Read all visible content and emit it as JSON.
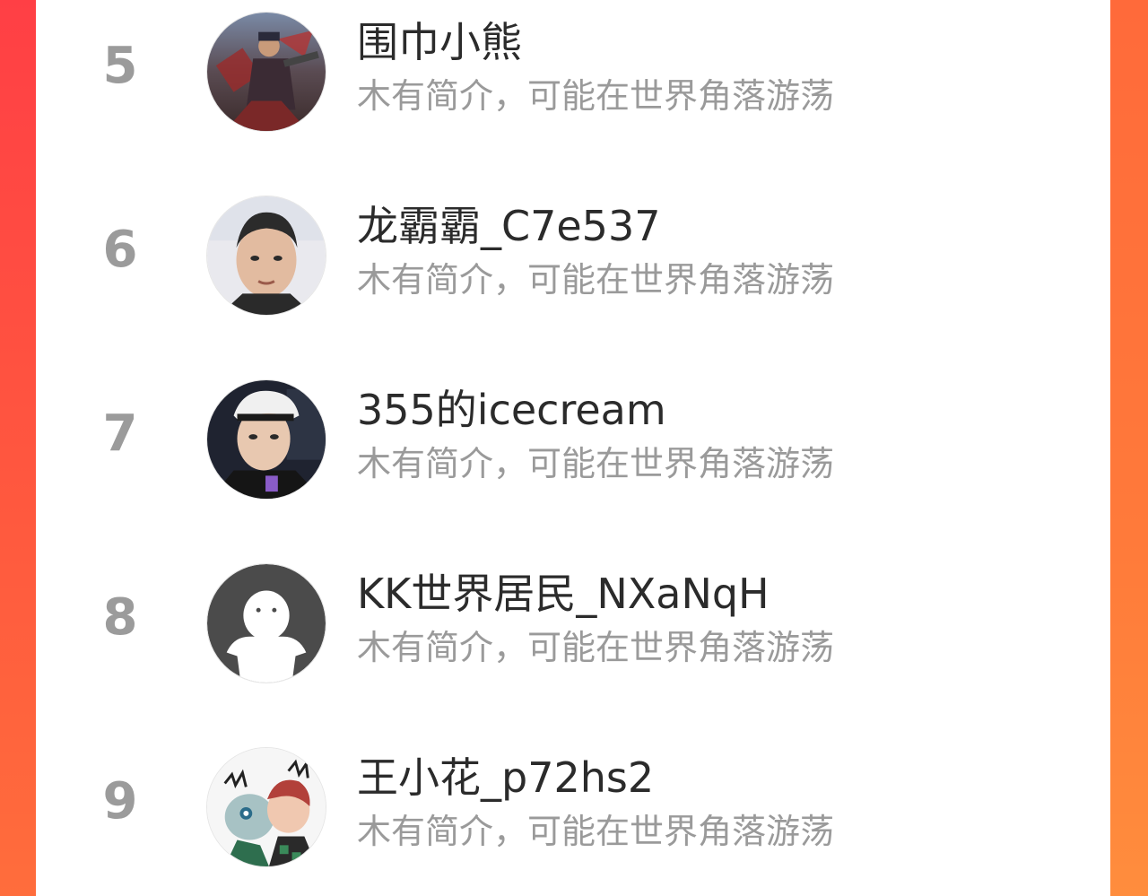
{
  "colors": {
    "accent": "#ff5a3e",
    "rank_gray": "#9b9b9b",
    "name_text": "#2b2b2b",
    "bio_text": "#9a9a9a",
    "card_bg": "#ffffff"
  },
  "ranking": {
    "items": [
      {
        "rank": "5",
        "name": "围巾小熊",
        "bio": "木有简介，可能在世界角落游荡",
        "avatar": "game-hero-avatar"
      },
      {
        "rank": "6",
        "name": "龙霸霸_C7e537",
        "bio": "木有简介，可能在世界角落游荡",
        "avatar": "photo-avatar"
      },
      {
        "rank": "7",
        "name": "355的icecream",
        "bio": "木有简介，可能在世界角落游荡",
        "avatar": "photo-avatar-cap"
      },
      {
        "rank": "8",
        "name": "KK世界居民_NXaNqH",
        "bio": "木有简介，可能在世界角落游荡",
        "avatar": "default-avatar"
      },
      {
        "rank": "9",
        "name": "王小花_p72hs2",
        "bio": "木有简介，可能在世界角落游荡",
        "avatar": "anime-avatar"
      }
    ]
  }
}
